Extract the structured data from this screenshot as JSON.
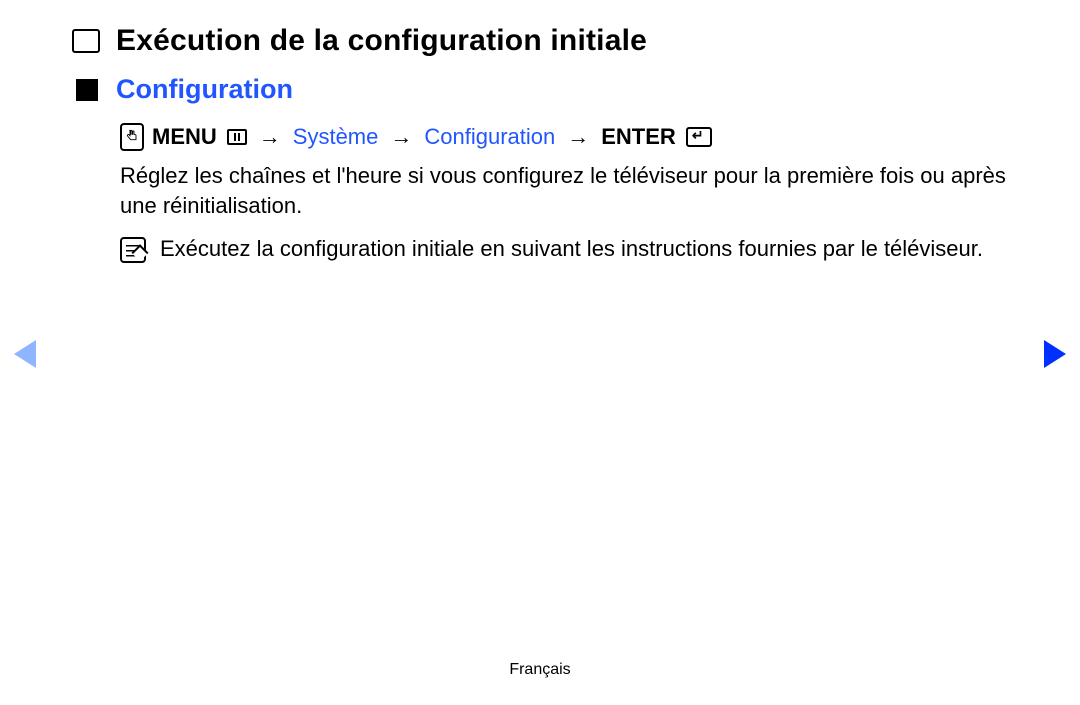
{
  "title": "Exécution de la configuration initiale",
  "subtitle": "Configuration",
  "nav": {
    "menu_label": "MENU",
    "arrow": "→",
    "path1": "Système",
    "path2": "Configuration",
    "enter_label": "ENTER"
  },
  "body": "Réglez les chaînes et l'heure si vous configurez le téléviseur pour la première fois ou après une réinitialisation.",
  "note": "Exécutez la configuration initiale en suivant les instructions fournies par le téléviseur.",
  "footer": "Français"
}
